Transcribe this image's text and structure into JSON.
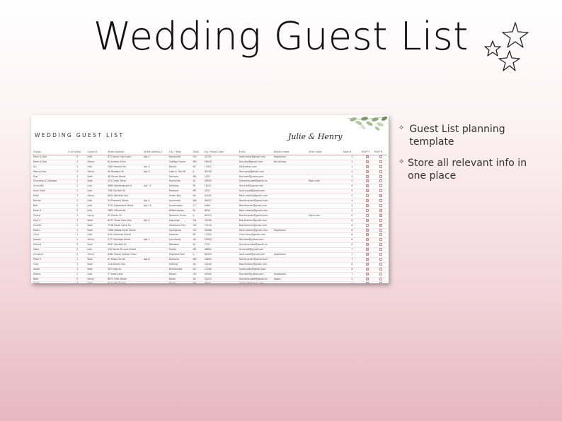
{
  "title": "Wedding Guest List",
  "sheet": {
    "title": "WEDDING GUEST LIST",
    "couple": "Julie & Henry",
    "columns": [
      "Guests",
      "# of Invites",
      "Guest of",
      "Street Address",
      "Street Address 2",
      "City / Town",
      "State",
      "Zip / Postal Code",
      "Email",
      "Dietary notes",
      "Other notes",
      "Table #",
      "RSVP Y",
      "RSVP N"
    ],
    "rows": [
      [
        "Mom & Dad",
        "2",
        "Julie",
        "872 North Lilac Lane",
        "Apt 4",
        "Danesville",
        "OH",
        "43701",
        "mom.mom@gmail.com",
        "Vegetarian",
        "",
        "1",
        true,
        false
      ],
      [
        "Mom & Dad",
        "2",
        "Henry",
        "84 Amelia Drive",
        "",
        "Cottage Grove",
        "MN",
        "55016",
        "Dad.dad@gmail.com",
        "Nut allergy",
        "",
        "1",
        true,
        false
      ],
      [
        "Sis",
        "1",
        "Julie",
        "208 Fremont Rd.",
        "Apt 5",
        "Dorley",
        "NY",
        "17907",
        "Sis@yahoo.com",
        "",
        "",
        "1",
        true,
        false
      ],
      [
        "Henry's bro",
        "3",
        "Henry",
        "90 Brewery St.",
        "Apt 3",
        "Lake In The Hil",
        "IL",
        "60156",
        "Henry.bro@gmail.com",
        "",
        "",
        "1",
        true,
        false
      ],
      [
        "Pop",
        "2",
        "Both",
        "48 Street Street",
        "",
        "Danvers",
        "MA",
        "1923",
        "Pop.beet@yahoo.com",
        "",
        "",
        "5",
        true,
        false
      ],
      [
        "Grandma & Grandpa",
        "2",
        "Both",
        "251 Cedar Drive",
        "",
        "Huntsville",
        "AL",
        "35803",
        "Grandma.beet@gmail.co",
        "",
        "High chair",
        "5",
        true,
        false
      ],
      [
        "Uncle Bill",
        "2",
        "Julie",
        "9660 Ramblewood St.",
        "Apt 15",
        "Hadleton",
        "PA",
        "18201",
        "Uncle.bill@gmail.com",
        "",
        "",
        "6",
        true,
        false
      ],
      [
        "Aunt Susie",
        "1",
        "Julie",
        "796 Old York St.",
        "",
        "Portland",
        "ME",
        "4101",
        "Aunt.susie@gmail.com",
        "",
        "",
        "5",
        true,
        false
      ],
      [
        "Mark",
        "1",
        "Henry",
        "8620 Windfall Ave",
        "",
        "Green Bay",
        "WI",
        "54302",
        "Mark.roberts@gmail.com",
        "",
        "",
        "5",
        false,
        true
      ],
      [
        "Rachel",
        "2",
        "Julie",
        "34 Pleasant Street",
        "Apt 4",
        "Lynnwood",
        "WA",
        "98037",
        "Rachel.green@gmail.com",
        "",
        "",
        "4",
        true,
        false
      ],
      [
        "Bob",
        "2",
        "Julie",
        "9751 Edgewood Street",
        "Apt 14",
        "Southington",
        "CT",
        "6489",
        "Bob.theman@gmail.com",
        "",
        "",
        "4",
        true,
        false
      ],
      [
        "Mark H",
        "2",
        "Julie",
        "7862 Hillside Dr.",
        "",
        "Williamstown",
        "NJ",
        "8094",
        "Mark.roberts@gmail.com",
        "",
        "",
        "2",
        false,
        true
      ],
      [
        "Cheryl",
        "3",
        "Henry",
        "95 Parker St.",
        "",
        "Downers Grove",
        "IL",
        "60515",
        "Rachel.green@gmail.com",
        "",
        "High chair",
        "6",
        false,
        true
      ],
      [
        "Sam C.",
        "2",
        "Both",
        "8477 Studs Farm Ave",
        "Apt 2",
        "Lagrange",
        "GA",
        "30240",
        "Bob.theman@gmail.com",
        "",
        "",
        "6",
        true,
        false
      ],
      [
        "Charlie",
        "2",
        "Both",
        "7018 North Canal Dr.",
        "",
        "Oklahoma City",
        "OK",
        "73110",
        "Bob.theman@gmail.com",
        "",
        "",
        "6",
        false,
        true
      ],
      [
        "Matt L.",
        "1",
        "Both",
        "7486 Middle River Street",
        "",
        "Springboro",
        "OH",
        "45066",
        "Mark.roberts@gmail.com",
        "Vegetarian",
        "",
        "6",
        true,
        false
      ],
      [
        "Chris",
        "1",
        "Julie",
        "643 Columbia Street",
        "",
        "Lebanon",
        "PA",
        "17042",
        "Chris.harry@gmail.com",
        "",
        "",
        "6",
        true,
        false
      ],
      [
        "Joseph",
        "2",
        "Henry",
        "377 Olmridge Street",
        "Apt 1",
        "Lynchburg",
        "VA",
        "24502",
        "Pop.beet@yahoo.com",
        "",
        "",
        "6",
        true,
        false
      ],
      [
        "Monica",
        "3",
        "Both",
        "8647 Windfall Dr.",
        "",
        "Matawan",
        "NJ",
        "7747",
        "Grandma.beet@gmail.co",
        "",
        "",
        "6",
        true,
        false
      ],
      [
        "Gaby",
        "3",
        "Julie",
        "120 North St Louis Street",
        "",
        "Tupelo",
        "MS",
        "38801",
        "Uncle.bill@gmail.com",
        "",
        "",
        "7",
        true,
        false
      ],
      [
        "Christine",
        "2",
        "Henry",
        "8382 Manor Station Stree",
        "",
        "Highland Park",
        "IL",
        "60035",
        "Aunt.susie@gmail.com",
        "Vegetarian",
        "",
        "7",
        true,
        false
      ],
      [
        "Peter P.",
        "1",
        "Both",
        "87 Ridge Street",
        "Apt 8",
        "Rockville",
        "MD",
        "20850",
        "Rachel.green@gmail.com",
        "",
        "",
        "7",
        true,
        false
      ],
      [
        "Cina",
        "1",
        "Both",
        "154 Steven Ave",
        "",
        "Sterling",
        "VA",
        "20164",
        "Bob.theman@gmail.com",
        "",
        "",
        "8",
        true,
        false
      ],
      [
        "Sarah",
        "3",
        "Both",
        "387 High Dr.",
        "",
        "Kernersville",
        "NC",
        "27284",
        "Sarah.salty@gmail.com",
        "",
        "",
        "8",
        true,
        false
      ],
      [
        "Emma",
        "2",
        "Julie",
        "37 Nate Lane",
        "",
        "Mason",
        "OH",
        "45040",
        "Pop.beet@yahoo.com",
        "Vegetarian",
        "",
        "7",
        true,
        false
      ],
      [
        "Beth",
        "2",
        "Henry",
        "8671 Fifth Street",
        "",
        "Burke",
        "VA",
        "22015",
        "Grandma.beet@gmail.co",
        "Vegan",
        "",
        "1",
        true,
        false
      ],
      [
        "Jamie",
        "3",
        "Both",
        "55 Creek Street",
        "",
        "Dover",
        "NH",
        "3820",
        "Uncle.bill@gmail.com",
        "",
        "",
        "1",
        true,
        false
      ],
      [
        "Brynn",
        "3",
        "Julie",
        "9041 East Sherwood Driv",
        "",
        "Grand Forks",
        "ND",
        "58201",
        "Aunt.susie@gmail.com",
        "",
        "High Chair",
        "2",
        true,
        false
      ],
      [
        "Kimberley",
        "2",
        "Henry",
        "278 Branch Avenue",
        "",
        "Teaneck",
        "NJ",
        "7666",
        "Rachel.green@gmail.com",
        "",
        "",
        "",
        true,
        false
      ],
      [
        "Jessica",
        "1",
        "Both",
        "1 Meadow Drive",
        "",
        "Clifton",
        "NJ",
        "7011",
        "Bob.theman@gmail.com",
        "Nut allergy",
        "",
        "",
        true,
        false
      ]
    ]
  },
  "bullets": [
    {
      "icon": "sparkle-icon",
      "text": "Guest List planning template"
    },
    {
      "icon": "sparkle-icon",
      "text": "Store all relevant info in one place"
    }
  ],
  "colors": {
    "accent": "#c38f9a",
    "checked": "#e7c0c8"
  }
}
